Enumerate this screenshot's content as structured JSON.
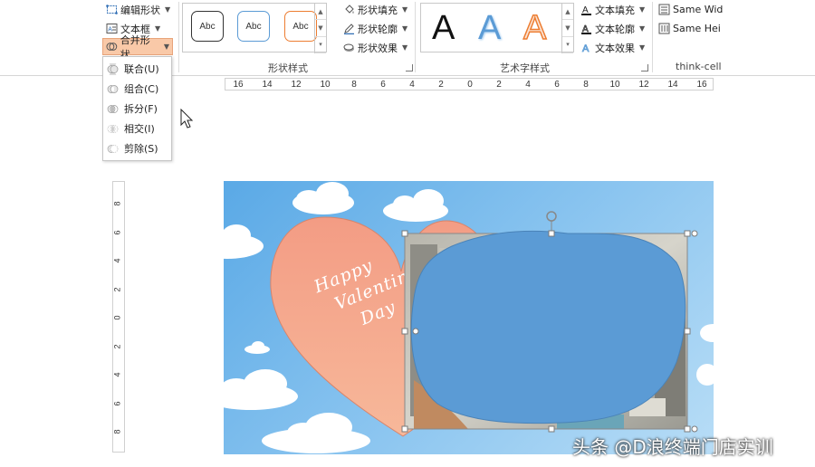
{
  "ribbon": {
    "edit_shape_label": "编辑形状",
    "text_box_label": "文本框",
    "merge_shapes_label": "合并形状",
    "shape_style_sample": "Abc",
    "shape_fill_label": "形状填充",
    "shape_outline_label": "形状轮廓",
    "shape_effects_label": "形状效果",
    "shape_styles_group": "形状样式",
    "wordart_letter": "A",
    "text_fill_label": "文本填充",
    "text_outline_label": "文本轮廓",
    "text_effects_label": "文本效果",
    "wordart_group": "艺术字样式",
    "same_width_label": "Same Wid",
    "same_height_label": "Same Hei",
    "thinkcell_group": "think-cell"
  },
  "merge_menu": {
    "items": [
      {
        "label": "联合(U)"
      },
      {
        "label": "组合(C)"
      },
      {
        "label": "拆分(F)"
      },
      {
        "label": "相交(I)"
      },
      {
        "label": "剪除(S)"
      }
    ]
  },
  "ruler": {
    "h_numbers": [
      "16",
      "14",
      "12",
      "10",
      "8",
      "6",
      "4",
      "2",
      "0",
      "2",
      "4",
      "6",
      "8",
      "10",
      "12",
      "14",
      "16"
    ],
    "v_numbers": [
      "8",
      "6",
      "4",
      "2",
      "0",
      "2",
      "4",
      "6",
      "8"
    ]
  },
  "slide": {
    "heart_text": [
      "Happy",
      "Valentine",
      "Day"
    ]
  },
  "watermark": "头条 @D浪终端门店实训",
  "colors": {
    "accent": "#f9c9a8",
    "blob": "#5b9bd5",
    "heart": "#f4a98a"
  }
}
